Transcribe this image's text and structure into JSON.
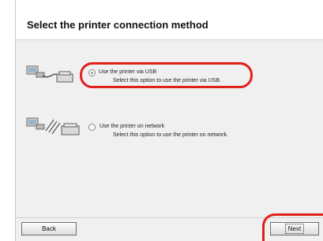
{
  "window": {
    "title": "Select the printer connection method"
  },
  "options": [
    {
      "label": "Use the printer via USB",
      "description": "Select this option to use the printer via USB.",
      "selected": true,
      "icon": "usb-connection-icon"
    },
    {
      "label": "Use the printer on network",
      "description": "Select this option to use the printer on network.",
      "selected": false,
      "icon": "network-connection-icon"
    }
  ],
  "buttons": {
    "back_label": "Back",
    "next_label": "Next"
  },
  "colors": {
    "highlight": "#e0201a",
    "panel": "#f0f0f0"
  }
}
